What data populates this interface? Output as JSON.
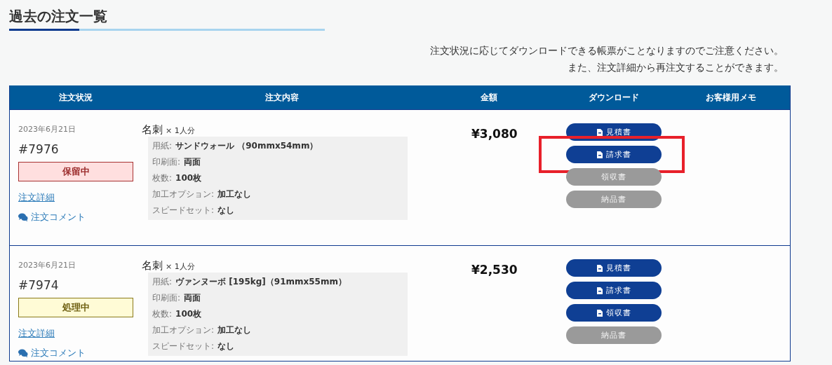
{
  "title": "過去の注文一覧",
  "notice": [
    "注文状況に応じてダウンロードできる帳票がことなりますのでご注意ください。",
    "また、注文詳細から再注文することができます。"
  ],
  "table": {
    "columns": [
      "注文状況",
      "注文内容",
      "金額",
      "ダウンロード",
      "お客様用メモ"
    ],
    "rows": [
      {
        "date": "2023年6月21日",
        "number": "#7976",
        "status": {
          "label": "保留中",
          "kind": "hold"
        },
        "detail_link": "注文詳細",
        "comment_link": "注文コメント",
        "product": "名刺",
        "quantity": "× 1人分",
        "specs": [
          {
            "label": "用紙:",
            "value": "サンドウォール （90mmx54mm）"
          },
          {
            "label": "印刷面:",
            "value": "両面"
          },
          {
            "label": "枚数:",
            "value": "100枚"
          },
          {
            "label": "加工オプション:",
            "value": "加工なし"
          },
          {
            "label": "スピードセット:",
            "value": "なし"
          }
        ],
        "amount": "¥3,080",
        "downloads": [
          {
            "label": "見積書",
            "disabled": false,
            "highlighted": false
          },
          {
            "label": "請求書",
            "disabled": false,
            "highlighted": true
          },
          {
            "label": "領収書",
            "disabled": true,
            "highlighted": false
          },
          {
            "label": "納品書",
            "disabled": true,
            "highlighted": false
          }
        ]
      },
      {
        "date": "2023年6月21日",
        "number": "#7974",
        "status": {
          "label": "処理中",
          "kind": "processing"
        },
        "detail_link": "注文詳細",
        "comment_link": "注文コメント",
        "product": "名刺",
        "quantity": "× 1人分",
        "specs": [
          {
            "label": "用紙:",
            "value": "ヴァンヌーボ [195kg]（91mmx55mm）"
          },
          {
            "label": "印刷面:",
            "value": "両面"
          },
          {
            "label": "枚数:",
            "value": "100枚"
          },
          {
            "label": "加工オプション:",
            "value": "加工なし"
          },
          {
            "label": "スピードセット:",
            "value": "なし"
          }
        ],
        "amount": "¥2,530",
        "downloads": [
          {
            "label": "見積書",
            "disabled": false,
            "highlighted": false
          },
          {
            "label": "請求書",
            "disabled": false,
            "highlighted": false
          },
          {
            "label": "領収書",
            "disabled": false,
            "highlighted": false
          },
          {
            "label": "納品書",
            "disabled": true,
            "highlighted": false
          }
        ]
      }
    ]
  }
}
